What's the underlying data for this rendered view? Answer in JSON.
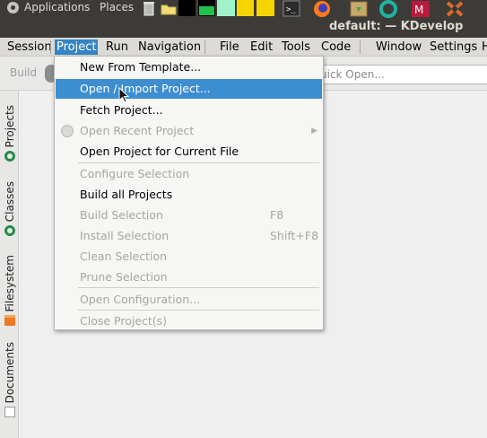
{
  "top_panel": {
    "applications_label": "Applications",
    "places_label": "Places",
    "window_title": "default: — KDevelop",
    "tray_icons": [
      "trash-icon",
      "folder-icon",
      "black-square-icon",
      "green-square-icon",
      "mint-square-icon",
      "yellow-square-icon",
      "yellow-square-icon",
      "terminal-icon",
      "firefox-icon",
      "package-icon",
      "circle-app-icon",
      "mendeley-icon",
      "tool-icon"
    ]
  },
  "menubar": {
    "items": [
      "Session",
      "Project",
      "Run",
      "Navigation",
      "File",
      "Edit",
      "Tools",
      "Code",
      "Window",
      "Settings",
      "H"
    ],
    "active": "Project"
  },
  "toolbar": {
    "build_label": "Build",
    "quick_open_placeholder": "uick Open..."
  },
  "left_dock": {
    "tabs": [
      "Projects",
      "Classes",
      "Filesystem",
      "Documents"
    ]
  },
  "project_menu": {
    "items": [
      {
        "label": "New From Template...",
        "enabled": true
      },
      {
        "label": "Open / Import Project...",
        "enabled": true,
        "highlighted": true
      },
      {
        "label": "Fetch Project...",
        "enabled": true
      },
      {
        "label": "Open Recent Project",
        "enabled": false,
        "submenu": true
      },
      {
        "label": "Open Project for Current File",
        "enabled": true
      },
      {
        "label": "Configure Selection",
        "enabled": false
      },
      {
        "label": "Build all Projects",
        "enabled": true
      },
      {
        "label": "Build Selection",
        "enabled": false,
        "shortcut": "F8"
      },
      {
        "label": "Install Selection",
        "enabled": false,
        "shortcut": "Shift+F8"
      },
      {
        "label": "Clean Selection",
        "enabled": false
      },
      {
        "label": "Prune Selection",
        "enabled": false
      },
      {
        "label": "Open Configuration...",
        "enabled": false
      },
      {
        "label": "Close Project(s)",
        "enabled": false
      }
    ]
  },
  "colors": {
    "highlight": "#3d8ed1",
    "panel_bg": "#3c3b37",
    "disabled_text": "#a6a6a3"
  }
}
